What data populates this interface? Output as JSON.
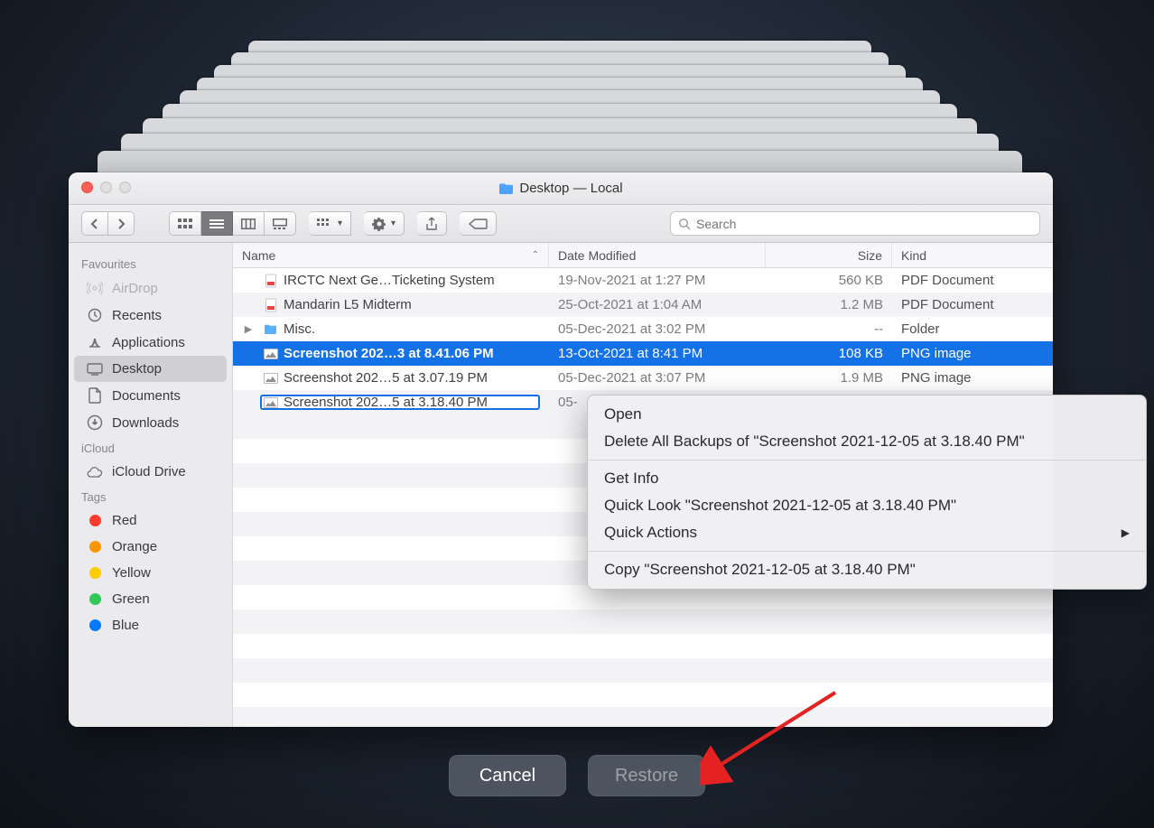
{
  "window": {
    "title": "Desktop — Local",
    "search_placeholder": "Search"
  },
  "sidebar": {
    "sections": [
      {
        "heading": "Favourites",
        "items": [
          {
            "label": "AirDrop",
            "icon": "airdrop",
            "dim": true
          },
          {
            "label": "Recents",
            "icon": "recents"
          },
          {
            "label": "Applications",
            "icon": "apps"
          },
          {
            "label": "Desktop",
            "icon": "desktop",
            "selected": true
          },
          {
            "label": "Documents",
            "icon": "documents"
          },
          {
            "label": "Downloads",
            "icon": "downloads"
          }
        ]
      },
      {
        "heading": "iCloud",
        "items": [
          {
            "label": "iCloud Drive",
            "icon": "icloud"
          }
        ]
      },
      {
        "heading": "Tags",
        "items": [
          {
            "label": "Red",
            "icon": "dot",
            "color": "#ff3b30"
          },
          {
            "label": "Orange",
            "icon": "dot",
            "color": "#ff9500"
          },
          {
            "label": "Yellow",
            "icon": "dot",
            "color": "#ffcc00"
          },
          {
            "label": "Green",
            "icon": "dot",
            "color": "#34c759"
          },
          {
            "label": "Blue",
            "icon": "dot",
            "color": "#007aff",
            "cut": true
          }
        ]
      }
    ]
  },
  "columns": {
    "name": "Name",
    "date": "Date Modified",
    "size": "Size",
    "kind": "Kind"
  },
  "files": [
    {
      "name": "IRCTC Next Ge…Ticketing System",
      "date": "19-Nov-2021 at 1:27 PM",
      "size": "560 KB",
      "kind": "PDF Document",
      "icon": "pdf"
    },
    {
      "name": "Mandarin L5 Midterm",
      "date": "25-Oct-2021 at 1:04 AM",
      "size": "1.2 MB",
      "kind": "PDF Document",
      "icon": "pdf"
    },
    {
      "name": "Misc.",
      "date": "05-Dec-2021 at 3:02 PM",
      "size": "--",
      "kind": "Folder",
      "icon": "folder",
      "expandable": true
    },
    {
      "name": "Screenshot 202…3 at 8.41.06 PM",
      "date": "13-Oct-2021 at 8:41 PM",
      "size": "108 KB",
      "kind": "PNG image",
      "icon": "png",
      "selected": true
    },
    {
      "name": "Screenshot 202…5 at 3.07.19 PM",
      "date": "05-Dec-2021 at 3:07 PM",
      "size": "1.9 MB",
      "kind": "PNG image",
      "icon": "png"
    },
    {
      "name": "Screenshot 202…5 at 3.18.40 PM",
      "date": "05-",
      "size": "",
      "kind": "",
      "icon": "png",
      "outlined": true
    }
  ],
  "context_menu": {
    "items": [
      {
        "label": "Open"
      },
      {
        "label": "Delete All Backups of \"Screenshot 2021-12-05 at 3.18.40 PM\""
      },
      {
        "separator": true
      },
      {
        "label": "Get Info"
      },
      {
        "label": "Quick Look \"Screenshot 2021-12-05 at 3.18.40 PM\""
      },
      {
        "label": "Quick Actions",
        "submenu": true
      },
      {
        "separator": true
      },
      {
        "label": "Copy \"Screenshot 2021-12-05 at 3.18.40 PM\""
      }
    ]
  },
  "actions": {
    "cancel": "Cancel",
    "restore": "Restore"
  }
}
